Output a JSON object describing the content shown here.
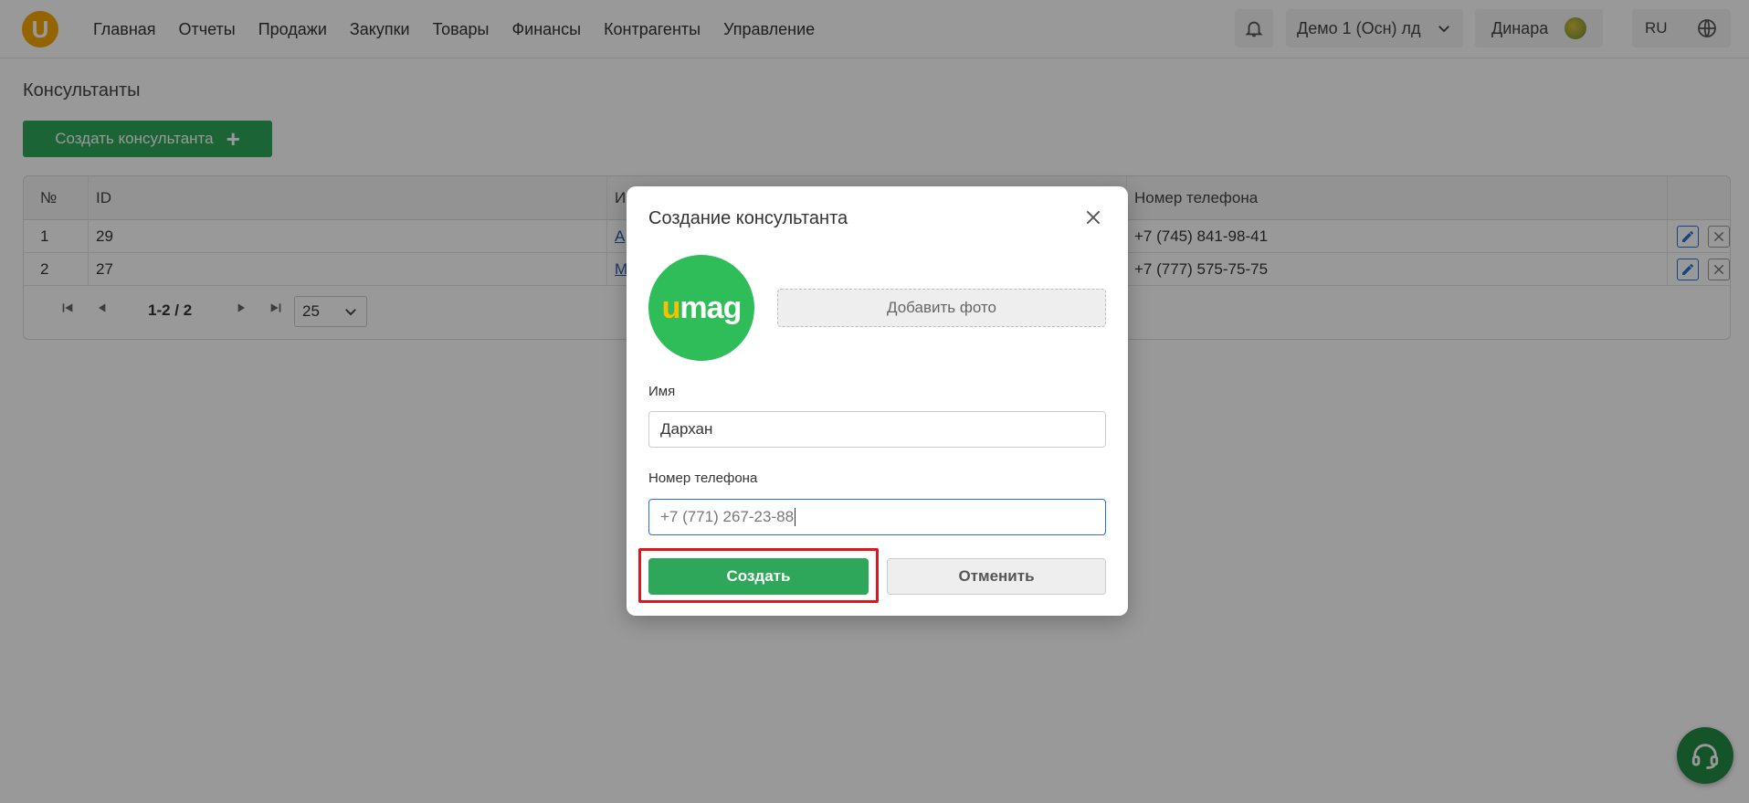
{
  "header": {
    "logo_letter": "U",
    "nav": [
      "Главная",
      "Отчеты",
      "Продажи",
      "Закупки",
      "Товары",
      "Финансы",
      "Контрагенты",
      "Управление"
    ],
    "company": "Демо 1 (Осн) лд",
    "user": "Динара",
    "lang": "RU"
  },
  "page": {
    "title": "Консультанты",
    "create_button": "Создать консультанта"
  },
  "table": {
    "headers": {
      "no": "№",
      "id": "ID",
      "name": "И",
      "phone": "Номер телефона"
    },
    "rows": [
      {
        "no": "1",
        "id": "29",
        "name": "А",
        "phone": "+7 (745) 841-98-41"
      },
      {
        "no": "2",
        "id": "27",
        "name": "М",
        "phone": "+7 (777) 575-75-75"
      }
    ]
  },
  "pager": {
    "range": "1-2 / 2",
    "page_size": "25"
  },
  "modal": {
    "title": "Создание консультанта",
    "avatar_text_u": "u",
    "avatar_text_rest": "mag",
    "add_photo": "Добавить фото",
    "name_label": "Имя",
    "name_value": "Дархан",
    "phone_label": "Номер телефона",
    "phone_value": "+7 (771) 267-23-88",
    "create_button": "Создать",
    "cancel_button": "Отменить"
  },
  "colors": {
    "accent_green": "#2ea75a",
    "logo_yellow": "#f5a700",
    "highlight_red": "#e0161e",
    "link_blue": "#2a5db0"
  }
}
